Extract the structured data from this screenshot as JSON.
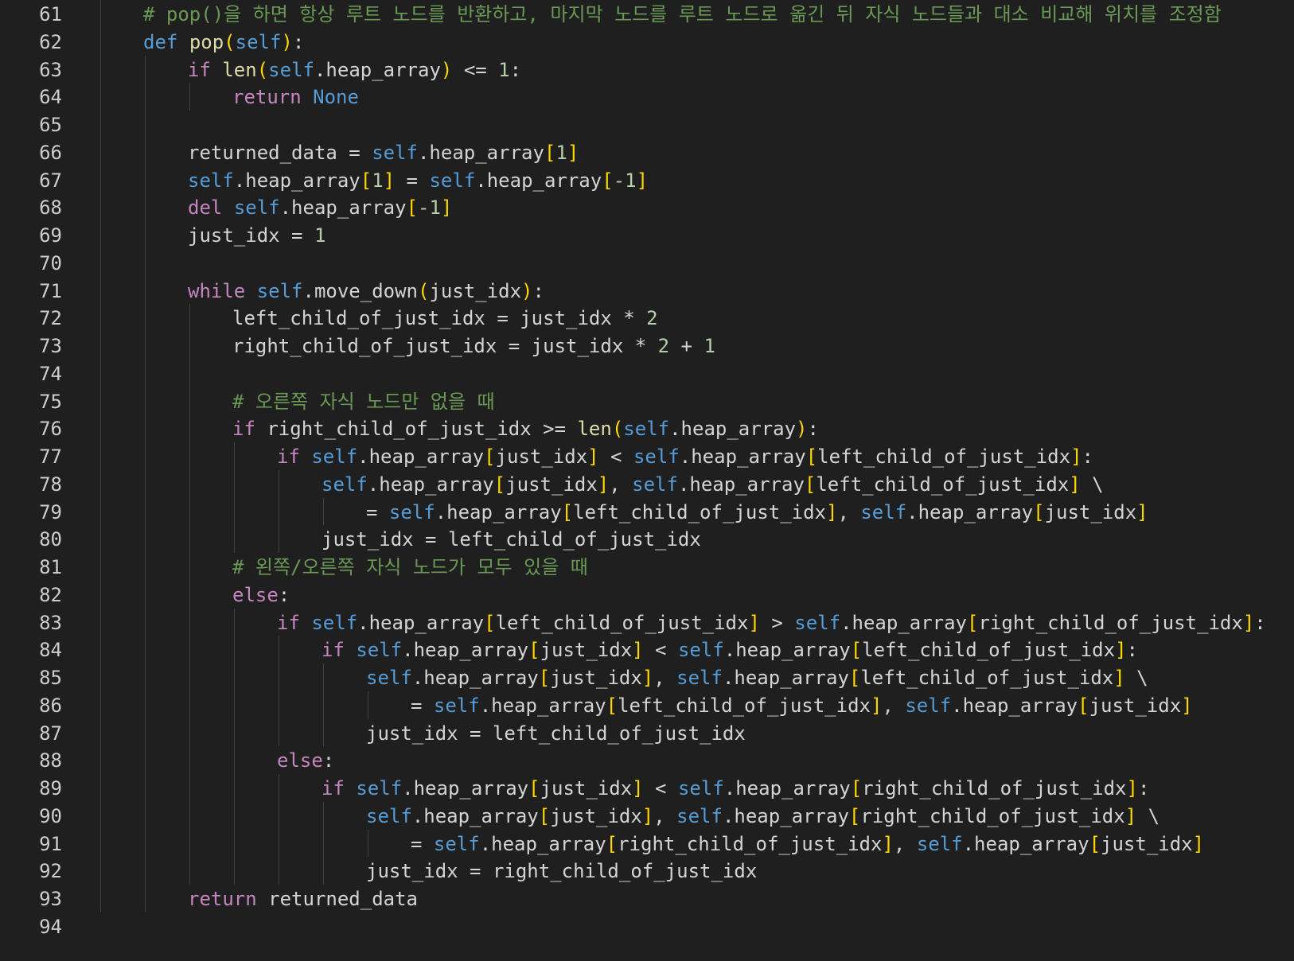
{
  "editor": {
    "theme": {
      "background": "#1f1f1f",
      "keyword": "#c586c0",
      "def_keyword": "#569cd6",
      "function": "#dcdcaa",
      "self": "#569cd6",
      "number": "#b5cea8",
      "bracket": "#ffd700",
      "comment": "#6a9955",
      "text": "#d4d4d4",
      "line_number": "#cdcdcd"
    },
    "lines": [
      {
        "num": "61",
        "indent": 2,
        "tokens": [
          [
            "cm",
            "# pop()을 하면 항상 루트 노드를 반환하고, 마지막 노드를 루트 노드로 옮긴 뒤 자식 노드들과 대소 비교해 위치를 조정함"
          ]
        ]
      },
      {
        "num": "62",
        "indent": 2,
        "tokens": [
          [
            "def",
            "def"
          ],
          [
            "var",
            " "
          ],
          [
            "fn",
            "pop"
          ],
          [
            "br",
            "("
          ],
          [
            "slf",
            "self"
          ],
          [
            "br",
            ")"
          ],
          [
            "var",
            ":"
          ]
        ]
      },
      {
        "num": "63",
        "indent": 3,
        "tokens": [
          [
            "ctl",
            "if"
          ],
          [
            "var",
            " "
          ],
          [
            "fn",
            "len"
          ],
          [
            "br",
            "("
          ],
          [
            "slf",
            "self"
          ],
          [
            "var",
            ".heap_array"
          ],
          [
            "br",
            ")"
          ],
          [
            "var",
            " <= "
          ],
          [
            "num",
            "1"
          ],
          [
            "var",
            ":"
          ]
        ]
      },
      {
        "num": "64",
        "indent": 4,
        "tokens": [
          [
            "ctl",
            "return"
          ],
          [
            "var",
            " "
          ],
          [
            "kwb",
            "None"
          ]
        ]
      },
      {
        "num": "65",
        "indent": 0,
        "tokens": []
      },
      {
        "num": "66",
        "indent": 3,
        "tokens": [
          [
            "var",
            "returned_data = "
          ],
          [
            "slf",
            "self"
          ],
          [
            "var",
            ".heap_array"
          ],
          [
            "br",
            "["
          ],
          [
            "num",
            "1"
          ],
          [
            "br",
            "]"
          ]
        ]
      },
      {
        "num": "67",
        "indent": 3,
        "tokens": [
          [
            "slf",
            "self"
          ],
          [
            "var",
            ".heap_array"
          ],
          [
            "br",
            "["
          ],
          [
            "num",
            "1"
          ],
          [
            "br",
            "]"
          ],
          [
            "var",
            " = "
          ],
          [
            "slf",
            "self"
          ],
          [
            "var",
            ".heap_array"
          ],
          [
            "br",
            "["
          ],
          [
            "num",
            "-1"
          ],
          [
            "br",
            "]"
          ]
        ]
      },
      {
        "num": "68",
        "indent": 3,
        "tokens": [
          [
            "ctl",
            "del"
          ],
          [
            "var",
            " "
          ],
          [
            "slf",
            "self"
          ],
          [
            "var",
            ".heap_array"
          ],
          [
            "br",
            "["
          ],
          [
            "num",
            "-1"
          ],
          [
            "br",
            "]"
          ]
        ]
      },
      {
        "num": "69",
        "indent": 3,
        "tokens": [
          [
            "var",
            "just_idx = "
          ],
          [
            "num",
            "1"
          ]
        ]
      },
      {
        "num": "70",
        "indent": 0,
        "tokens": []
      },
      {
        "num": "71",
        "indent": 3,
        "tokens": [
          [
            "ctl",
            "while"
          ],
          [
            "var",
            " "
          ],
          [
            "slf",
            "self"
          ],
          [
            "var",
            ".move_down"
          ],
          [
            "br",
            "("
          ],
          [
            "var",
            "just_idx"
          ],
          [
            "br",
            ")"
          ],
          [
            "var",
            ":"
          ]
        ]
      },
      {
        "num": "72",
        "indent": 4,
        "tokens": [
          [
            "var",
            "left_child_of_just_idx = just_idx * "
          ],
          [
            "num",
            "2"
          ]
        ]
      },
      {
        "num": "73",
        "indent": 4,
        "tokens": [
          [
            "var",
            "right_child_of_just_idx = just_idx * "
          ],
          [
            "num",
            "2"
          ],
          [
            "var",
            " + "
          ],
          [
            "num",
            "1"
          ]
        ]
      },
      {
        "num": "74",
        "indent": 0,
        "tokens": []
      },
      {
        "num": "75",
        "indent": 4,
        "tokens": [
          [
            "cm",
            "# 오른쪽 자식 노드만 없을 때"
          ]
        ]
      },
      {
        "num": "76",
        "indent": 4,
        "tokens": [
          [
            "ctl",
            "if"
          ],
          [
            "var",
            " right_child_of_just_idx >= "
          ],
          [
            "fn",
            "len"
          ],
          [
            "br",
            "("
          ],
          [
            "slf",
            "self"
          ],
          [
            "var",
            ".heap_array"
          ],
          [
            "br",
            ")"
          ],
          [
            "var",
            ":"
          ]
        ]
      },
      {
        "num": "77",
        "indent": 5,
        "tokens": [
          [
            "ctl",
            "if"
          ],
          [
            "var",
            " "
          ],
          [
            "slf",
            "self"
          ],
          [
            "var",
            ".heap_array"
          ],
          [
            "br",
            "["
          ],
          [
            "var",
            "just_idx"
          ],
          [
            "br",
            "]"
          ],
          [
            "var",
            " < "
          ],
          [
            "slf",
            "self"
          ],
          [
            "var",
            ".heap_array"
          ],
          [
            "br",
            "["
          ],
          [
            "var",
            "left_child_of_just_idx"
          ],
          [
            "br",
            "]"
          ],
          [
            "var",
            ":"
          ]
        ]
      },
      {
        "num": "78",
        "indent": 6,
        "tokens": [
          [
            "slf",
            "self"
          ],
          [
            "var",
            ".heap_array"
          ],
          [
            "br",
            "["
          ],
          [
            "var",
            "just_idx"
          ],
          [
            "br",
            "]"
          ],
          [
            "var",
            ", "
          ],
          [
            "slf",
            "self"
          ],
          [
            "var",
            ".heap_array"
          ],
          [
            "br",
            "["
          ],
          [
            "var",
            "left_child_of_just_idx"
          ],
          [
            "br",
            "]"
          ],
          [
            "var",
            " \\"
          ]
        ]
      },
      {
        "num": "79",
        "indent": 7,
        "tokens": [
          [
            "var",
            "= "
          ],
          [
            "slf",
            "self"
          ],
          [
            "var",
            ".heap_array"
          ],
          [
            "br",
            "["
          ],
          [
            "var",
            "left_child_of_just_idx"
          ],
          [
            "br",
            "]"
          ],
          [
            "var",
            ", "
          ],
          [
            "slf",
            "self"
          ],
          [
            "var",
            ".heap_array"
          ],
          [
            "br",
            "["
          ],
          [
            "var",
            "just_idx"
          ],
          [
            "br",
            "]"
          ]
        ]
      },
      {
        "num": "80",
        "indent": 6,
        "tokens": [
          [
            "var",
            "just_idx = left_child_of_just_idx"
          ]
        ]
      },
      {
        "num": "81",
        "indent": 4,
        "tokens": [
          [
            "cm",
            "# 왼쪽/오른쪽 자식 노드가 모두 있을 때"
          ]
        ]
      },
      {
        "num": "82",
        "indent": 4,
        "tokens": [
          [
            "ctl",
            "else"
          ],
          [
            "var",
            ":"
          ]
        ]
      },
      {
        "num": "83",
        "indent": 5,
        "tokens": [
          [
            "ctl",
            "if"
          ],
          [
            "var",
            " "
          ],
          [
            "slf",
            "self"
          ],
          [
            "var",
            ".heap_array"
          ],
          [
            "br",
            "["
          ],
          [
            "var",
            "left_child_of_just_idx"
          ],
          [
            "br",
            "]"
          ],
          [
            "var",
            " > "
          ],
          [
            "slf",
            "self"
          ],
          [
            "var",
            ".heap_array"
          ],
          [
            "br",
            "["
          ],
          [
            "var",
            "right_child_of_just_idx"
          ],
          [
            "br",
            "]"
          ],
          [
            "var",
            ":"
          ]
        ]
      },
      {
        "num": "84",
        "indent": 6,
        "tokens": [
          [
            "ctl",
            "if"
          ],
          [
            "var",
            " "
          ],
          [
            "slf",
            "self"
          ],
          [
            "var",
            ".heap_array"
          ],
          [
            "br",
            "["
          ],
          [
            "var",
            "just_idx"
          ],
          [
            "br",
            "]"
          ],
          [
            "var",
            " < "
          ],
          [
            "slf",
            "self"
          ],
          [
            "var",
            ".heap_array"
          ],
          [
            "br",
            "["
          ],
          [
            "var",
            "left_child_of_just_idx"
          ],
          [
            "br",
            "]"
          ],
          [
            "var",
            ":"
          ]
        ]
      },
      {
        "num": "85",
        "indent": 7,
        "tokens": [
          [
            "slf",
            "self"
          ],
          [
            "var",
            ".heap_array"
          ],
          [
            "br",
            "["
          ],
          [
            "var",
            "just_idx"
          ],
          [
            "br",
            "]"
          ],
          [
            "var",
            ", "
          ],
          [
            "slf",
            "self"
          ],
          [
            "var",
            ".heap_array"
          ],
          [
            "br",
            "["
          ],
          [
            "var",
            "left_child_of_just_idx"
          ],
          [
            "br",
            "]"
          ],
          [
            "var",
            " \\"
          ]
        ]
      },
      {
        "num": "86",
        "indent": 8,
        "tokens": [
          [
            "var",
            "= "
          ],
          [
            "slf",
            "self"
          ],
          [
            "var",
            ".heap_array"
          ],
          [
            "br",
            "["
          ],
          [
            "var",
            "left_child_of_just_idx"
          ],
          [
            "br",
            "]"
          ],
          [
            "var",
            ", "
          ],
          [
            "slf",
            "self"
          ],
          [
            "var",
            ".heap_array"
          ],
          [
            "br",
            "["
          ],
          [
            "var",
            "just_idx"
          ],
          [
            "br",
            "]"
          ]
        ]
      },
      {
        "num": "87",
        "indent": 7,
        "tokens": [
          [
            "var",
            "just_idx = left_child_of_just_idx"
          ]
        ]
      },
      {
        "num": "88",
        "indent": 5,
        "tokens": [
          [
            "ctl",
            "else"
          ],
          [
            "var",
            ":"
          ]
        ]
      },
      {
        "num": "89",
        "indent": 6,
        "tokens": [
          [
            "ctl",
            "if"
          ],
          [
            "var",
            " "
          ],
          [
            "slf",
            "self"
          ],
          [
            "var",
            ".heap_array"
          ],
          [
            "br",
            "["
          ],
          [
            "var",
            "just_idx"
          ],
          [
            "br",
            "]"
          ],
          [
            "var",
            " < "
          ],
          [
            "slf",
            "self"
          ],
          [
            "var",
            ".heap_array"
          ],
          [
            "br",
            "["
          ],
          [
            "var",
            "right_child_of_just_idx"
          ],
          [
            "br",
            "]"
          ],
          [
            "var",
            ":"
          ]
        ]
      },
      {
        "num": "90",
        "indent": 7,
        "tokens": [
          [
            "slf",
            "self"
          ],
          [
            "var",
            ".heap_array"
          ],
          [
            "br",
            "["
          ],
          [
            "var",
            "just_idx"
          ],
          [
            "br",
            "]"
          ],
          [
            "var",
            ", "
          ],
          [
            "slf",
            "self"
          ],
          [
            "var",
            ".heap_array"
          ],
          [
            "br",
            "["
          ],
          [
            "var",
            "right_child_of_just_idx"
          ],
          [
            "br",
            "]"
          ],
          [
            "var",
            " \\"
          ]
        ]
      },
      {
        "num": "91",
        "indent": 8,
        "tokens": [
          [
            "var",
            "= "
          ],
          [
            "slf",
            "self"
          ],
          [
            "var",
            ".heap_array"
          ],
          [
            "br",
            "["
          ],
          [
            "var",
            "right_child_of_just_idx"
          ],
          [
            "br",
            "]"
          ],
          [
            "var",
            ", "
          ],
          [
            "slf",
            "self"
          ],
          [
            "var",
            ".heap_array"
          ],
          [
            "br",
            "["
          ],
          [
            "var",
            "just_idx"
          ],
          [
            "br",
            "]"
          ]
        ]
      },
      {
        "num": "92",
        "indent": 7,
        "tokens": [
          [
            "var",
            "just_idx = right_child_of_just_idx"
          ]
        ]
      },
      {
        "num": "93",
        "indent": 3,
        "tokens": [
          [
            "ctl",
            "return"
          ],
          [
            "var",
            " returned_data"
          ]
        ]
      },
      {
        "num": "94",
        "indent": 0,
        "tokens": []
      }
    ]
  }
}
